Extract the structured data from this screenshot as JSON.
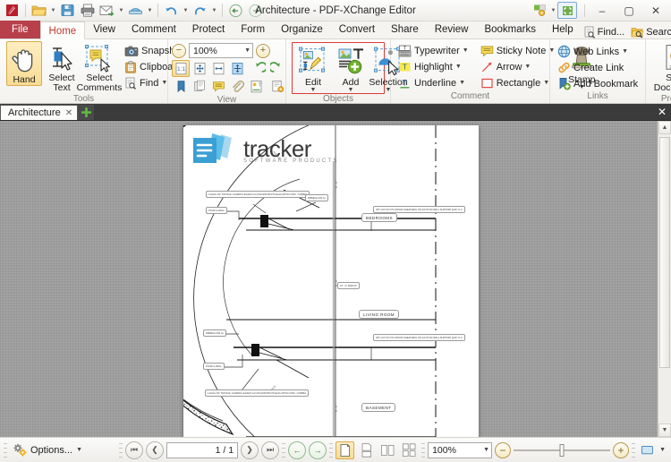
{
  "window": {
    "title": "Architecture - PDF-XChange Editor",
    "minimize": "–",
    "maximize": "▢",
    "close": "✕"
  },
  "quick_access": [
    {
      "name": "app-logo-icon",
      "label": "app-logo"
    },
    {
      "name": "open-icon",
      "label": "Open"
    },
    {
      "name": "save-icon",
      "label": "Save"
    },
    {
      "name": "print-icon",
      "label": "Print"
    },
    {
      "name": "email-icon",
      "label": "Email"
    },
    {
      "name": "scan-icon",
      "label": "Scan"
    },
    {
      "name": "undo-icon",
      "label": "Undo"
    },
    {
      "name": "redo-icon",
      "label": "Redo"
    },
    {
      "name": "back-icon",
      "label": "Back"
    },
    {
      "name": "forward-icon",
      "label": "Forward"
    }
  ],
  "menu": {
    "tabs": [
      {
        "label": "File",
        "state": "file"
      },
      {
        "label": "Home",
        "state": "active"
      },
      {
        "label": "View",
        "state": "normal"
      },
      {
        "label": "Comment",
        "state": "normal"
      },
      {
        "label": "Protect",
        "state": "normal"
      },
      {
        "label": "Form",
        "state": "normal"
      },
      {
        "label": "Organize",
        "state": "normal"
      },
      {
        "label": "Convert",
        "state": "normal"
      },
      {
        "label": "Share",
        "state": "normal"
      },
      {
        "label": "Review",
        "state": "normal"
      },
      {
        "label": "Bookmarks",
        "state": "normal"
      },
      {
        "label": "Help",
        "state": "normal"
      }
    ],
    "find_label": "Find...",
    "search_label": "Search...",
    "collapse_glyph": "⌃"
  },
  "ribbon": {
    "tools": {
      "group_label": "Tools",
      "hand": "Hand",
      "select_text": "Select\nText",
      "select_text_l1": "Select",
      "select_text_l2": "Text",
      "select_comments_l1": "Select",
      "select_comments_l2": "Comments",
      "snapshot": "Snapshot",
      "clipboard": "Clipboard",
      "find": "Find"
    },
    "view": {
      "group_label": "View",
      "zoom_value": "100%",
      "zoom_out": "−",
      "zoom_in": "+",
      "icons_row1": [
        "actual-size-icon",
        "fit-page-icon",
        "fit-width-icon",
        "fit-visible-icon",
        "rotate-left-icon",
        "rotate-right-icon"
      ],
      "icons_row2": [
        "bookmarks-pane-icon",
        "pages-pane-icon",
        "comments-pane-icon",
        "attachments-pane-icon",
        "signatures-pane-icon",
        "properties-pane-icon"
      ]
    },
    "objects": {
      "group_label": "Objects",
      "edit": "Edit",
      "add": "Add",
      "selection": "Selection",
      "highlight_color": "#e03a36"
    },
    "comment": {
      "group_label": "Comment",
      "typewriter": "Typewriter",
      "sticky_note": "Sticky Note",
      "highlight": "Highlight",
      "arrow": "Arrow",
      "underline": "Underline",
      "rectangle": "Rectangle",
      "stamp": "Stamp"
    },
    "links": {
      "group_label": "Links",
      "web_links": "Web Links",
      "create_link": "Create Link",
      "add_bookmark": "Add Bookmark"
    },
    "protect": {
      "group_label": "Protect",
      "sign_l1": "Sign",
      "sign_l2": "Document"
    }
  },
  "doc_tabs": {
    "tabs": [
      {
        "label": "Architecture",
        "close": "✕"
      }
    ],
    "new_tab": "✚",
    "close_all": "✕"
  },
  "document": {
    "logo_word": "tracker",
    "logo_sub": "SOFTWARE PRODUCTS",
    "room_labels": [
      "BEDROOMS",
      "LIVING ROOM",
      "BASEMENT"
    ],
    "callouts": [
      "1 EACH OF TOP RAIL GUARDS\nLEGADO 1/2 ANCHOR\nBOLTS EACH WITH CONC.\nCORBEL",
      "POUR-A-WALL",
      "FIBREGLASS 4s",
      "POUR-A-WALL",
      "1 EACH OF TOP RAIL GUARDS\nLEGADO 1/2 ANCHOR\nBOLTS EACH WITH CONC.\nCORBEL",
      "3/8\" CUT-OUT PLYWOOD\nSHEATHING ON 2x6 STUD\nWALL SUPPORT @16\" O.C.",
      "3/8\" CUT-OUT PLYWOOD\nSHEATHING ON 2x6 STUD\nWALL SUPPORT @16\" O.C.",
      "FIBREGLASS 4s",
      "10' - 0\" RADIUS"
    ]
  },
  "status": {
    "options": "Options...",
    "page_value": "1 / 1",
    "first_glyph": "⏮",
    "prev_glyph": "❮",
    "next_glyph": "❯",
    "last_glyph": "⏭",
    "back_glyph": "←",
    "forward_glyph": "→",
    "layout_icons": [
      "single-page-icon",
      "continuous-page-icon",
      "two-page-icon",
      "two-page-continuous-icon"
    ],
    "zoom_value": "100%",
    "zoom_out": "−",
    "zoom_in": "+",
    "fit_icon": "fit-visible-icon"
  }
}
